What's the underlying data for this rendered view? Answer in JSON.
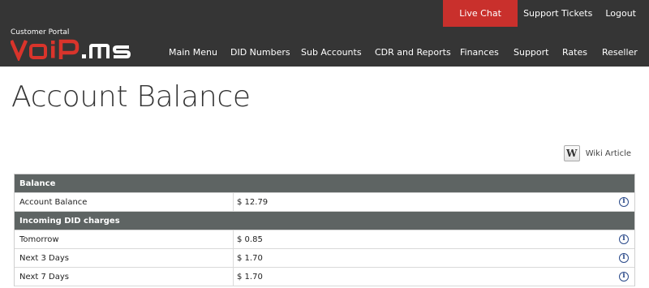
{
  "top_links": {
    "live_chat": "Live Chat",
    "support_tickets": "Support Tickets",
    "logout": "Logout"
  },
  "logo": {
    "caption": "Customer Portal",
    "text": "VoIP.ms"
  },
  "nav": [
    "Main Menu",
    "DID Numbers",
    "Sub Accounts",
    "CDR and Reports",
    "Finances",
    "Support",
    "Rates",
    "Reseller"
  ],
  "page_title": "Account Balance",
  "wiki": {
    "label": "Wiki Article",
    "icon": "W"
  },
  "sections": [
    {
      "title": "Balance",
      "rows": [
        {
          "label": "Account Balance",
          "value": "$ 12.79"
        }
      ]
    },
    {
      "title": "Incoming DID charges",
      "rows": [
        {
          "label": "Tomorrow",
          "value": "$ 0.85"
        },
        {
          "label": "Next 3 Days",
          "value": "$ 1.70"
        },
        {
          "label": "Next 7 Days",
          "value": "$ 1.70"
        }
      ]
    }
  ],
  "colors": {
    "header_bg": "#353535",
    "live_chat_bg": "#c9302c",
    "logo_red": "#d9342b",
    "section_header_bg": "#5e6463",
    "info_icon": "#2b4a8a"
  }
}
